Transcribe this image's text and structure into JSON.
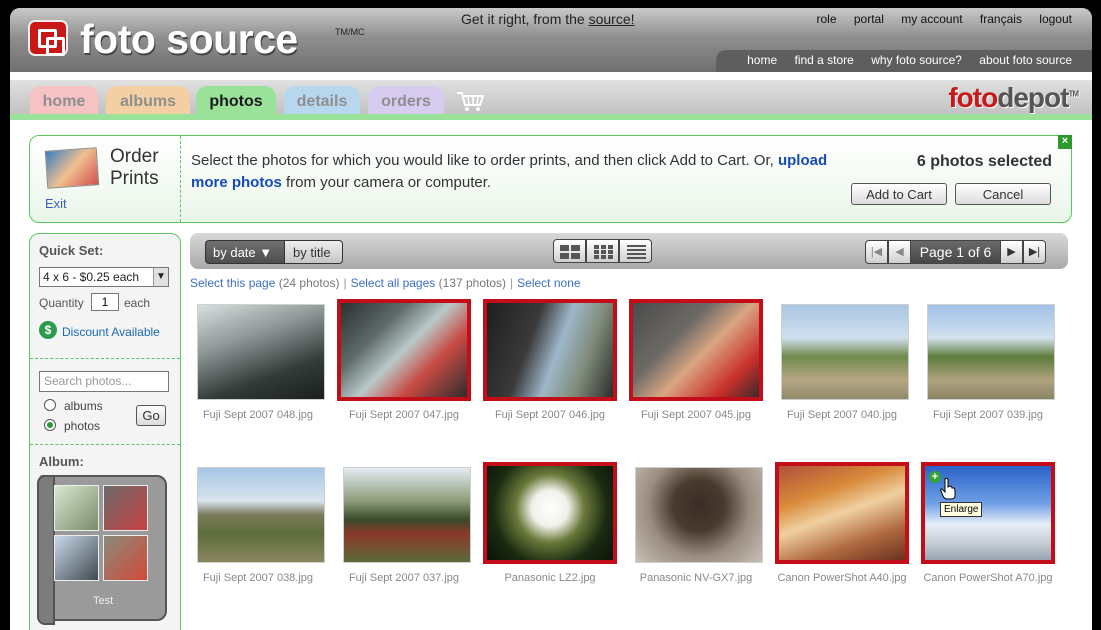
{
  "header": {
    "brand": "foto source",
    "trademark": "TM/MC",
    "tagline_text": "Get it right, from the",
    "tagline_link": "source!",
    "top_links": [
      "role",
      "portal",
      "my account",
      "français",
      "logout"
    ],
    "sub_links": [
      "home",
      "find a store",
      "why foto source?",
      "about foto source"
    ]
  },
  "tabs": [
    {
      "label": "home"
    },
    {
      "label": "albums"
    },
    {
      "label": "photos",
      "active": true
    },
    {
      "label": "details"
    },
    {
      "label": "orders"
    }
  ],
  "partner_logo": {
    "part1": "foto",
    "part2": "depot",
    "trademark": "TM"
  },
  "order_box": {
    "title": "Order Prints",
    "exit_label": "Exit",
    "message_pre": "Select the photos for which you would like to order prints, and then click Add to Cart. Or,",
    "message_link": "upload more photos",
    "message_post": "from your camera or computer.",
    "selected_count": "6 photos selected",
    "add_to_cart_label": "Add to Cart",
    "cancel_label": "Cancel",
    "close_label": "×"
  },
  "sidebar": {
    "quick_set_label": "Quick Set:",
    "quick_set_value": "4 x 6 - $0.25 each",
    "quantity_label": "Quantity",
    "quantity_value": "1",
    "each_label": "each",
    "discount_label": "Discount Available",
    "search_placeholder": "Search photos...",
    "radio_albums": "albums",
    "radio_photos": "photos",
    "radio_selected": "photos",
    "go_label": "Go",
    "album_label": "Album:",
    "album_name": "Test"
  },
  "toolbar": {
    "sort_date_label": "by date ▼",
    "sort_title_label": "by title",
    "page_info": "Page 1 of 6"
  },
  "selection_bar": {
    "select_page": "Select this page",
    "page_count": "(24 photos)",
    "select_all": "Select all pages",
    "all_count": "(137 photos)",
    "select_none": "Select none",
    "separator": "|"
  },
  "photos": [
    {
      "name": "Fuji Sept 2007 048.jpg",
      "selected": false
    },
    {
      "name": "Fuji Sept 2007 047.jpg",
      "selected": true
    },
    {
      "name": "Fuji Sept 2007 046.jpg",
      "selected": true
    },
    {
      "name": "Fuji Sept 2007 045.jpg",
      "selected": true
    },
    {
      "name": "Fuji Sept 2007 040.jpg",
      "selected": false
    },
    {
      "name": "Fuji Sept 2007 039.jpg",
      "selected": false
    },
    {
      "name": "Fuji Sept 2007 038.jpg",
      "selected": false
    },
    {
      "name": "Fuji Sept 2007 037.jpg",
      "selected": false
    },
    {
      "name": "Panasonic LZ2.jpg",
      "selected": true
    },
    {
      "name": "Panasonic NV-GX7.jpg",
      "selected": false
    },
    {
      "name": "Canon PowerShot A40.jpg",
      "selected": true
    },
    {
      "name": "Canon PowerShot A70.jpg",
      "selected": true
    }
  ],
  "tooltip": "Enlarge",
  "colors": {
    "selected_border": "#c30d18",
    "accent_green": "#5fc65f",
    "brand_red": "#c81818",
    "link_blue": "#1849b8"
  }
}
